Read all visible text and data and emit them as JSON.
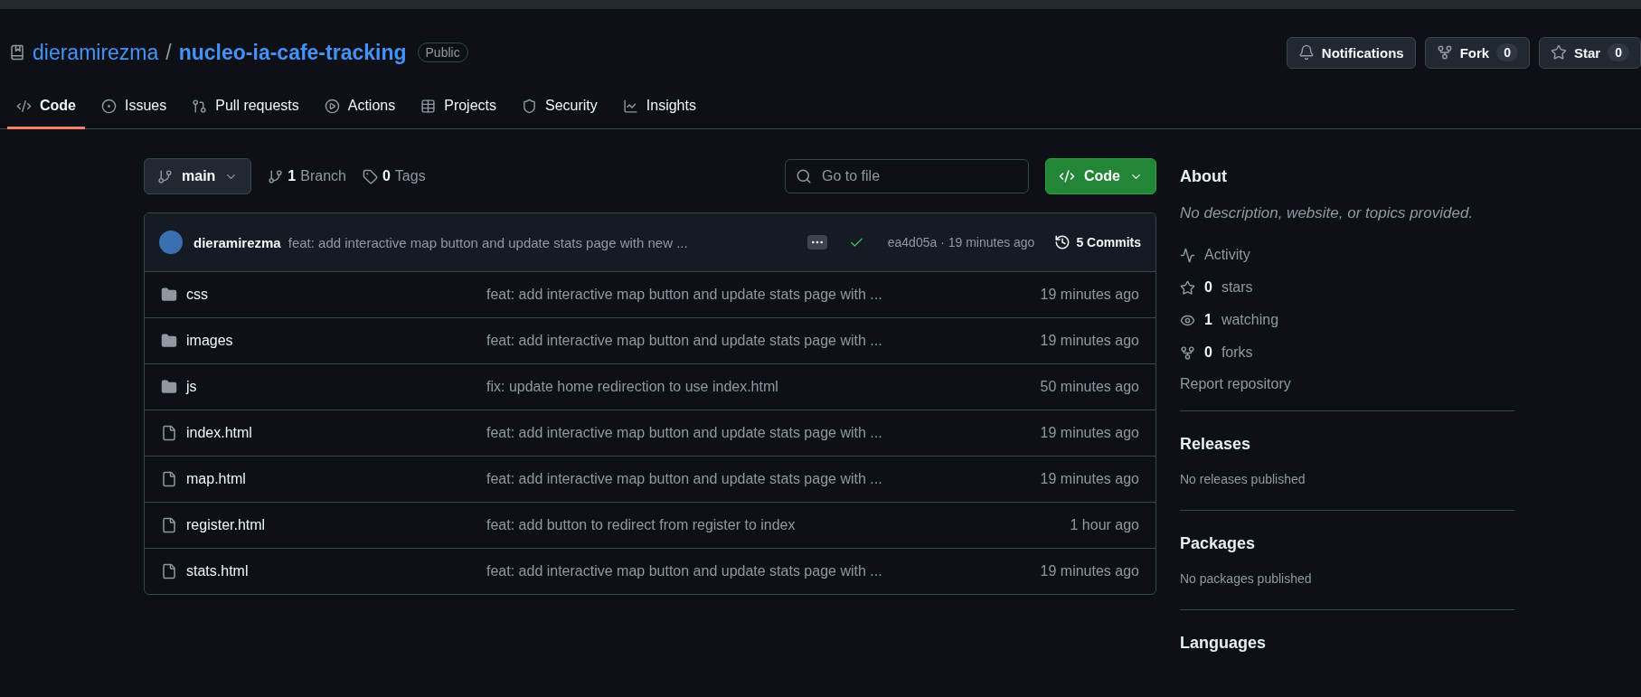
{
  "repo": {
    "owner": "dieramirezma",
    "separator": "/",
    "name": "nucleo-ia-cafe-tracking",
    "visibility": "Public"
  },
  "header_buttons": [
    {
      "label": "Notifications"
    },
    {
      "label": "Fork",
      "count": "0"
    },
    {
      "label": "Star",
      "count": "0"
    }
  ],
  "tabs": [
    {
      "label": "Code",
      "selected": true
    },
    {
      "label": "Issues",
      "selected": false
    },
    {
      "label": "Pull requests",
      "selected": false
    },
    {
      "label": "Actions",
      "selected": false
    },
    {
      "label": "Projects",
      "selected": false
    },
    {
      "label": "Security",
      "selected": false
    },
    {
      "label": "Insights",
      "selected": false
    }
  ],
  "branch_selector": {
    "name": "main"
  },
  "branches": {
    "count": "1",
    "label": "Branch"
  },
  "tags": {
    "count": "0",
    "label": "Tags"
  },
  "file_search": {
    "placeholder": "Go to file"
  },
  "code_button": {
    "label": "Code"
  },
  "latest_commit": {
    "author": "dieramirezma",
    "message": "feat: add interactive map button and update stats page with new ...",
    "checks_passed": true,
    "hash_time": "ea4d05a · 19 minutes ago",
    "commits": "5 Commits"
  },
  "files": [
    {
      "kind": "folder",
      "name": "css",
      "message": "feat: add interactive map button and update stats page with ...",
      "time": "19 minutes ago"
    },
    {
      "kind": "folder",
      "name": "images",
      "message": "feat: add interactive map button and update stats page with ...",
      "time": "19 minutes ago"
    },
    {
      "kind": "folder",
      "name": "js",
      "message": "fix: update home redirection to use index.html",
      "time": "50 minutes ago"
    },
    {
      "kind": "file",
      "name": "index.html",
      "message": "feat: add interactive map button and update stats page with ...",
      "time": "19 minutes ago"
    },
    {
      "kind": "file",
      "name": "map.html",
      "message": "feat: add interactive map button and update stats page with ...",
      "time": "19 minutes ago"
    },
    {
      "kind": "file",
      "name": "register.html",
      "message": "feat: add button to redirect from register to index",
      "time": "1 hour ago"
    },
    {
      "kind": "file",
      "name": "stats.html",
      "message": "feat: add interactive map button and update stats page with ...",
      "time": "19 minutes ago"
    }
  ],
  "about": {
    "title": "About",
    "description": "No description, website, or topics provided.",
    "stats": [
      {
        "label": "Activity"
      },
      {
        "count": "0",
        "label": "stars"
      },
      {
        "count": "1",
        "label": "watching"
      },
      {
        "count": "0",
        "label": "forks"
      }
    ],
    "report": "Report repository"
  },
  "sections": [
    {
      "title": "Releases",
      "note": "No releases published"
    },
    {
      "title": "Packages",
      "note": "No packages published"
    },
    {
      "title": "Languages"
    }
  ]
}
